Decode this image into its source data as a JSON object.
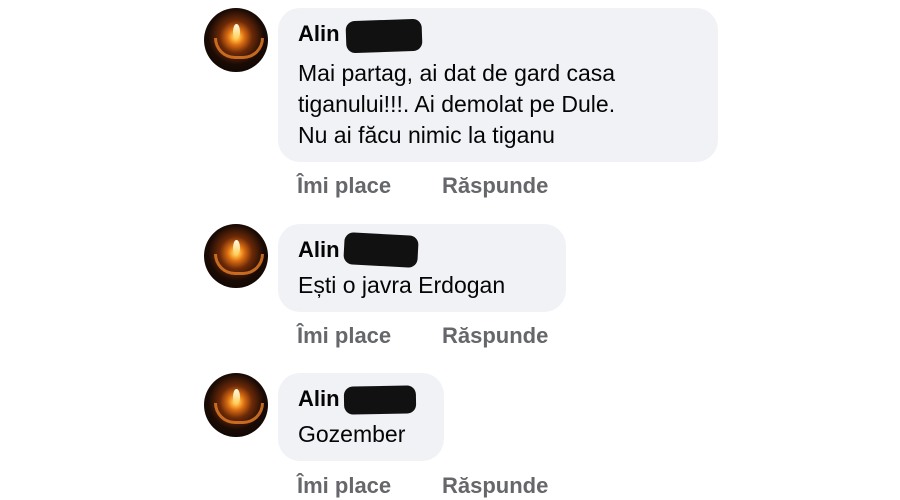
{
  "comments": [
    {
      "author": "Alin",
      "avatar_icon": "candle-hands-icon",
      "text_lines": [
        "Mai partag, ai dat de gard casa",
        "tiganului!!!. Ai demolat pe Dule.",
        "Nu ai făcu nimic la tiganu"
      ],
      "like_label": "Îmi place",
      "reply_label": "Răspunde"
    },
    {
      "author": "Alin",
      "avatar_icon": "candle-hands-icon",
      "text_lines": [
        "Ești o javra Erdogan"
      ],
      "like_label": "Îmi place",
      "reply_label": "Răspunde"
    },
    {
      "author": "Alin",
      "avatar_icon": "candle-hands-icon",
      "text_lines": [
        "Gozember"
      ],
      "like_label": "Îmi place",
      "reply_label": "Răspunde"
    }
  ],
  "colors": {
    "bubble": "#f0f2f5",
    "text": "#050505",
    "action": "#65676b",
    "redaction": "#111111"
  }
}
